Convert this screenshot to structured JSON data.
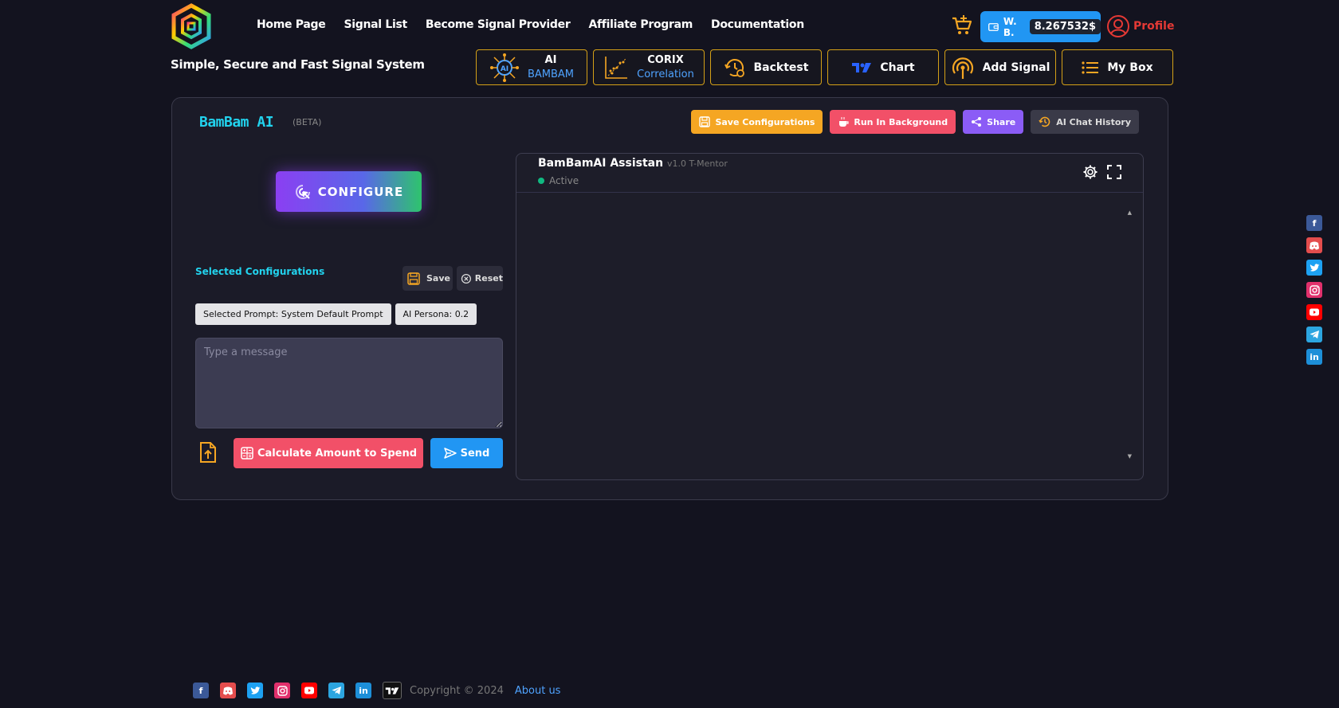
{
  "nav": {
    "items": [
      "Home Page",
      "Signal List",
      "Become Signal Provider",
      "Affiliate Program",
      "Documentation"
    ]
  },
  "tagline": "Simple, Secure and Fast Signal System",
  "wallet": {
    "label": "W. B.",
    "balance": "8.267532$"
  },
  "profile": {
    "label": "Profile"
  },
  "tools": {
    "ai": {
      "line1": "AI",
      "line2": "BAMBAM"
    },
    "corix": {
      "line1": "CORIX",
      "line2": "Correlation"
    },
    "backtest": "Backtest",
    "chart": "Chart",
    "add_signal": "Add Signal",
    "my_box": "My Box"
  },
  "card": {
    "title": "BamBam AI",
    "beta": "(BETA)",
    "buttons": {
      "save_configurations": "Save Configurations",
      "run_in_background": "Run In Background",
      "share": "Share",
      "ai_chat_history": "AI Chat History"
    },
    "configure_label": "CONFIGURE",
    "selected_configurations": "Selected Configurations",
    "save": "Save",
    "reset": "Reset",
    "chips": {
      "prompt": "Selected Prompt: System Default Prompt",
      "persona": "AI Persona: 0.2"
    },
    "message_placeholder": "Type a message",
    "calculate": "Calculate Amount to Spend",
    "send": "Send"
  },
  "assistant": {
    "name": "BamBamAI Assistan",
    "version": "v1.0 T-Mentor",
    "status": "Active"
  },
  "footer": {
    "copyright": "Copyright © 2024",
    "about": "About us"
  },
  "colors": {
    "background": "#13131f",
    "accent_gold": "#d4a017",
    "cyan": "#22d3ee",
    "blue": "#2196f3",
    "red": "#f25068",
    "purple": "#8b5cf6",
    "green": "#10b981"
  }
}
